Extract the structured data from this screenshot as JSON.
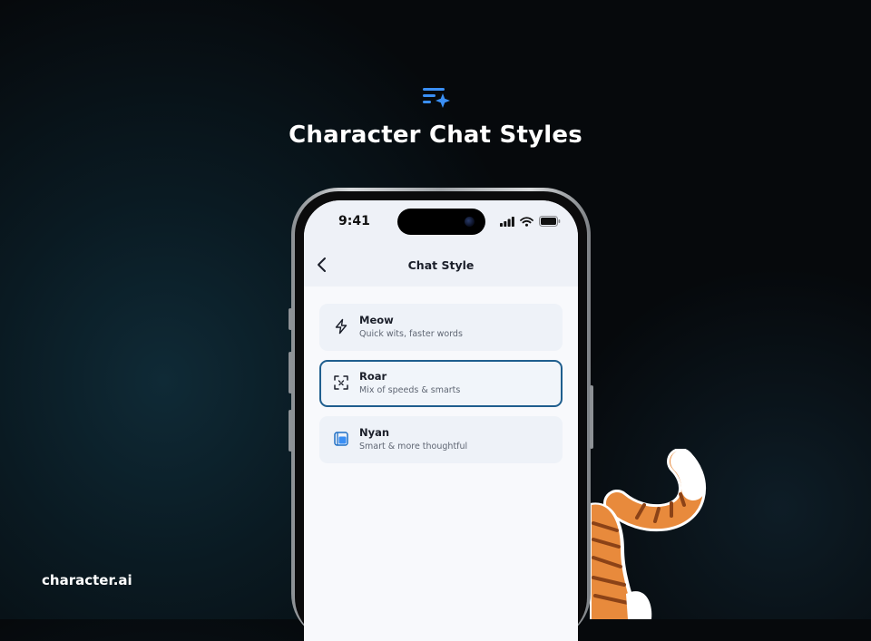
{
  "hero": {
    "icon": "sparkle-list-icon",
    "title": "Character Chat Styles"
  },
  "brand": {
    "name": "character.ai"
  },
  "status_bar": {
    "time": "9:41",
    "icons": [
      "signal-icon",
      "wifi-icon",
      "battery-icon"
    ]
  },
  "screen": {
    "title": "Chat Style",
    "back_icon": "chevron-left-icon"
  },
  "options": [
    {
      "title": "Meow",
      "subtitle": "Quick wits, faster words",
      "icon": "lightning-icon",
      "selected": false
    },
    {
      "title": "Roar",
      "subtitle": "Mix of speeds & smarts",
      "icon": "focus-frame-icon",
      "selected": true
    },
    {
      "title": "Nyan",
      "subtitle": "Smart & more thoughtful",
      "icon": "calendar-book-icon",
      "selected": false
    }
  ],
  "colors": {
    "accent_blue": "#2f8df0",
    "selected_border": "#1f5e8e",
    "background": "#06090c",
    "cat_orange": "#e88a3c"
  }
}
